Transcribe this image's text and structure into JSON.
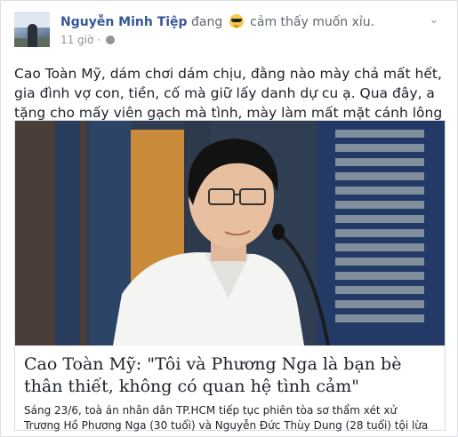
{
  "post": {
    "author": "Nguyễn Minh Tiệp",
    "status_verb": "đang",
    "feeling": "cảm thấy muốn xỉu.",
    "feeling_icon": "cool-sunglasses-emoji-icon",
    "time": "11 giờ ·",
    "privacy_icon": "globe-icon",
    "menu_icon": "chevron-down-icon",
    "text": "Cao Toàn Mỹ, dám chơi dám chịu, đằng nào mày chả mất hết, gia đình vợ con, tiền, cố mà giữ lấy danh dự cu ạ. Qua đây, a tặng cho mấy viên gạch mà tình, mày làm mất mặt cánh lông râu quá đấy."
  },
  "link": {
    "title": "Cao Toàn Mỹ: \"Tôi và Phương Nga là bạn bè thân thiết, không có quan hệ tình cảm\"",
    "description": "Sáng 23/6, toà án nhân dân TP.HCM tiếp tục phiên tòa sơ thẩm xét xử Trương Hồ Phương Nga (30 tuổi) và Nguyễn Đức Thùy Dung (28 tuổi) tội lừa đảo chiếm đoạt..."
  },
  "colors": {
    "link_name": "#365899",
    "muted": "#90949c",
    "text": "#1d2129"
  }
}
